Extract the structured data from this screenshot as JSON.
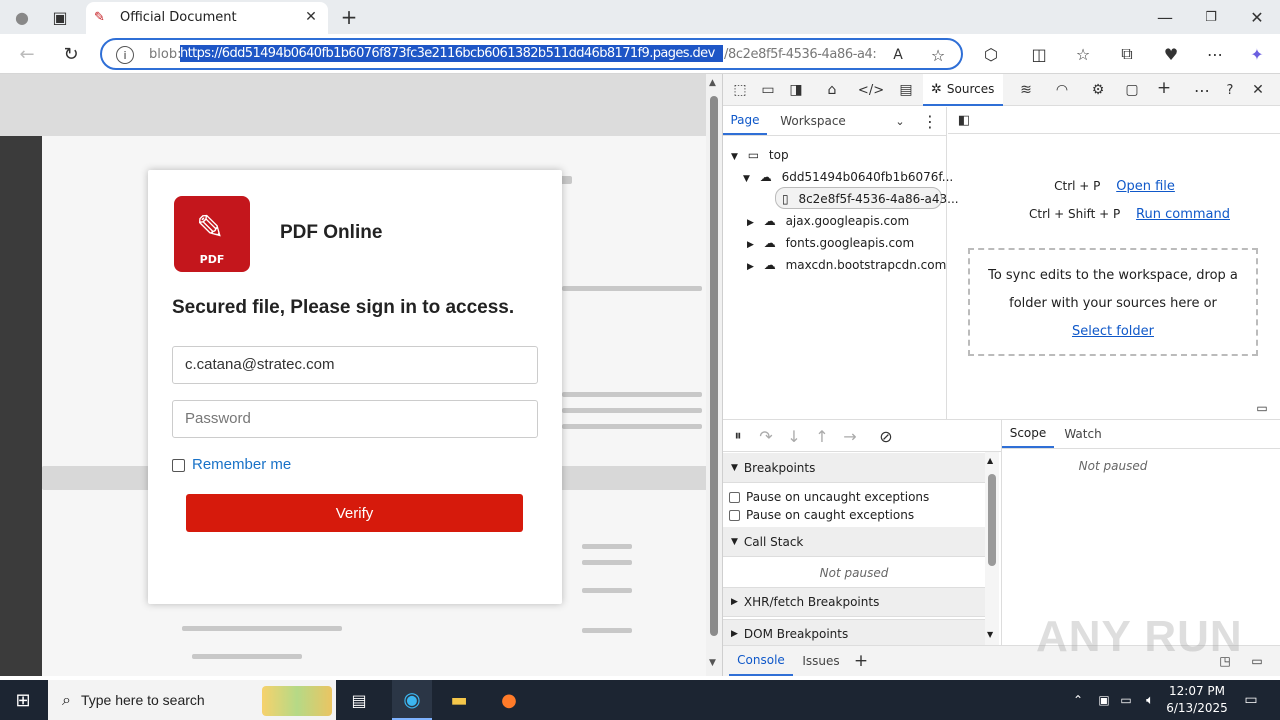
{
  "browser": {
    "tab_title": "Official Document",
    "url_prefix": "blob:",
    "url_host": "https://6dd51494b0640fb1b6076f873fc3e2116bcb6061382b511dd46b8171f9.pages.dev",
    "url_path": "/8c2e8f5f-4536-4a86-a4:"
  },
  "modal": {
    "logo_text": "PDF",
    "brand": "PDF Online",
    "heading": "Secured file, Please sign in to access.",
    "email_value": "c.catana@stratec.com",
    "password_placeholder": "Password",
    "remember_label": "Remember me",
    "verify_label": "Verify"
  },
  "devtools": {
    "active_tool": "Sources",
    "nav_tabs": [
      "Page",
      "Workspace"
    ],
    "tree": {
      "top": "top",
      "host": "6dd51494b0640fb1b6076f...",
      "file": "8c2e8f5f-4536-4a86-a43...",
      "domains": [
        "ajax.googleapis.com",
        "fonts.googleapis.com",
        "maxcdn.bootstrapcdn.com"
      ]
    },
    "shortcuts": [
      {
        "keys": "Ctrl + P",
        "action": "Open file"
      },
      {
        "keys": "Ctrl + Shift + P",
        "action": "Run command"
      }
    ],
    "workspace_hint": "To sync edits to the workspace, drop a folder with your sources here or",
    "select_folder": "Select folder",
    "breakpoints_title": "Breakpoints",
    "pause_uncaught": "Pause on uncaught exceptions",
    "pause_caught": "Pause on caught exceptions",
    "callstack_title": "Call Stack",
    "not_paused": "Not paused",
    "xhr_title": "XHR/fetch Breakpoints",
    "dom_title": "DOM Breakpoints",
    "scope_tabs": [
      "Scope",
      "Watch"
    ],
    "scope_status": "Not paused",
    "drawer_tabs": [
      "Console",
      "Issues"
    ]
  },
  "taskbar": {
    "search_placeholder": "Type here to search",
    "time": "12:07 PM",
    "date": "6/13/2025"
  },
  "watermark": "ANY RUN",
  "colors": {
    "accent": "#2f6fd6",
    "verify": "#d61a0c",
    "pdf_red": "#c4161c",
    "link": "#0f58c9"
  }
}
